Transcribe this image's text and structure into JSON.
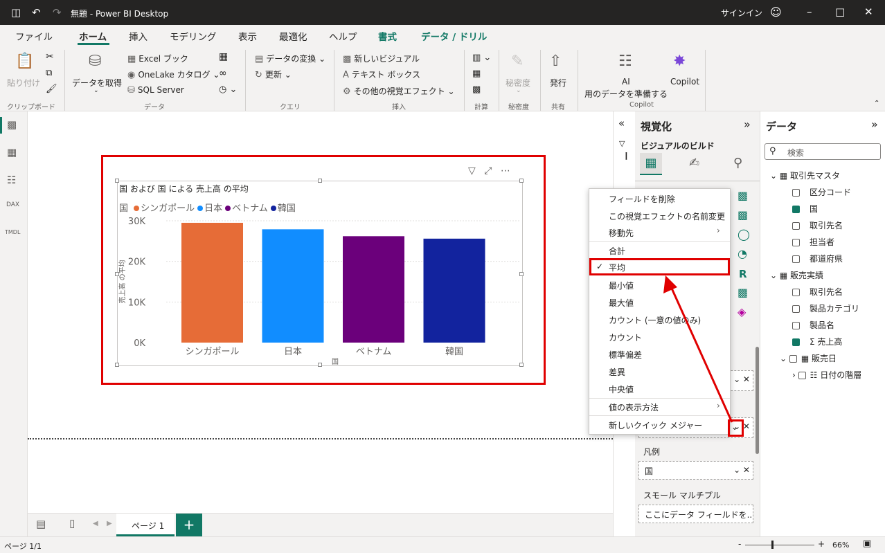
{
  "titlebar": {
    "title": "無題 - Power BI Desktop",
    "signin": "サインイン"
  },
  "menu": {
    "tabs": [
      "ファイル",
      "ホーム",
      "挿入",
      "モデリング",
      "表示",
      "最適化",
      "ヘルプ",
      "書式",
      "データ / ドリル"
    ],
    "share": "共有"
  },
  "ribbon": {
    "paste": "貼り付け",
    "clipboard_group": "クリップボード",
    "get_data": "データを取得",
    "excel": "Excel ブック",
    "onelake": "OneLake カタログ",
    "sql": "SQL Server",
    "data_group": "データ",
    "transform": "データの変換",
    "refresh": "更新",
    "query_group": "クエリ",
    "new_visual": "新しいビジュアル",
    "textbox": "テキスト ボックス",
    "more_visuals": "その他の視覚エフェクト",
    "insert_group": "挿入",
    "calc_group": "計算",
    "sensitivity": "秘密度",
    "sensitivity_group": "秘密度",
    "publish": "発行",
    "share_group": "共有",
    "ai_line1": "AI",
    "ai_line2": "用のデータを準備する",
    "copilot": "Copilot",
    "copilot_group": "Copilot"
  },
  "visual": {
    "title": "国 および 国 による 売上高 の平均",
    "legend_label": "国",
    "y_axis_label": "売上高 の平均",
    "x_axis_label": "国"
  },
  "chart_data": {
    "type": "bar",
    "categories": [
      "シンガポール",
      "日本",
      "ベトナム",
      "韓国"
    ],
    "values": [
      29500,
      27900,
      26200,
      25600
    ],
    "colors": [
      "#e66c37",
      "#118dff",
      "#6b007b",
      "#12239e"
    ],
    "yticks": [
      "0K",
      "10K",
      "20K",
      "30K"
    ],
    "ylim": [
      0,
      30000
    ],
    "grid": true,
    "legend_position": "top-left"
  },
  "bottom": {
    "page": "ページ 1",
    "add": "+",
    "status": "ページ 1/1",
    "zoom": "66%"
  },
  "viz_pane": {
    "title": "視覚化",
    "subtitle": "ビジュアルのビルド",
    "filters_label": "フィルター",
    "legend_well_label": "凡例",
    "legend_value": "国",
    "small_multiples_label": "スモール マルチプル",
    "small_multiples_placeholder": "ここにデータ フィールドを..."
  },
  "context_menu": {
    "items": [
      "フィールドを削除",
      "この視覚エフェクトの名前変更",
      "移動先",
      "合計",
      "平均",
      "最小値",
      "最大値",
      "カウント (一意の値のみ)",
      "カウント",
      "標準偏差",
      "差異",
      "中央値",
      "値の表示方法",
      "新しいクイック メジャー"
    ]
  },
  "data_pane": {
    "title": "データ",
    "search_placeholder": "検索",
    "tables": [
      {
        "name": "取引先マスタ",
        "fields": [
          {
            "name": "区分コード",
            "checked": false
          },
          {
            "name": "国",
            "checked": true
          },
          {
            "name": "取引先名",
            "checked": false
          },
          {
            "name": "担当者",
            "checked": false
          },
          {
            "name": "都道府県",
            "checked": false
          }
        ]
      },
      {
        "name": "販売実績",
        "fields": [
          {
            "name": "取引先名",
            "checked": false
          },
          {
            "name": "製品カテゴリ",
            "checked": false
          },
          {
            "name": "製品名",
            "checked": false
          },
          {
            "name": "売上高",
            "checked": true
          }
        ]
      }
    ],
    "date_field": "販売日",
    "date_hierarchy": "日付の階層"
  }
}
